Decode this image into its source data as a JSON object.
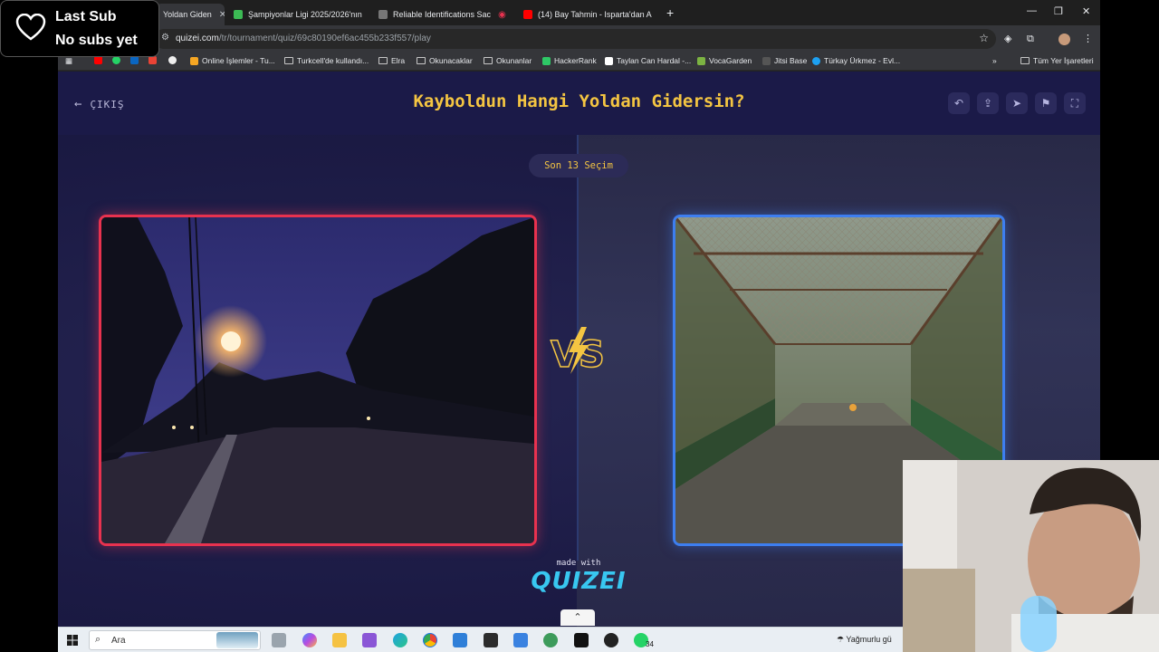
{
  "overlay": {
    "title": "Last Sub",
    "subtitle": "No subs yet"
  },
  "tabs": [
    {
      "label": "Yoldan Giden",
      "color": "#f4c542",
      "active": true
    },
    {
      "label": "Şampiyonlar Ligi 2025/2026'nın",
      "color": "#3cba54"
    },
    {
      "label": "Reliable Identifications Sac",
      "color": "#a0a0a0"
    },
    {
      "label": "(14) Bay Tahmin - Isparta'dan A",
      "color": "#ff0000"
    }
  ],
  "address": {
    "domain": "quizei.com",
    "path": "/tr/tournament/quiz/69c80190ef6ac455b233f557/play"
  },
  "bookmarks": [
    "Online İşlemler - Tu...",
    "Turkcell'de kullandı...",
    "Elra",
    "Okunacaklar",
    "Okunanlar",
    "HackerRank",
    "Taylan Can Hardal -...",
    "VocaGarden",
    "Jitsi Base",
    "Türkay Ürkmez - Evl...",
    "Tüm Yer İşaretleri"
  ],
  "page": {
    "exit_label": "ÇIKIŞ",
    "title": "Kayboldun Hangi Yoldan Gidersin?",
    "round_label": "Son 13 Seçim",
    "made_with": "made with",
    "brand": "QUIZEI",
    "left_choice": "night-road-streetlight-image",
    "right_choice": "covered-rusty-footbridge-image"
  },
  "taskbar": {
    "search_placeholder": "Ara",
    "weather": "Yağmurlu gü",
    "badge_count": "34"
  },
  "colors": {
    "accent_yellow": "#f4c542",
    "left_border": "#e8324f",
    "right_border": "#3d7ef0",
    "page_bg": "#1d1c4a"
  }
}
